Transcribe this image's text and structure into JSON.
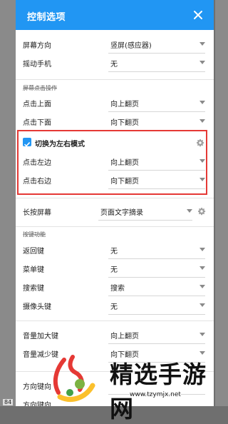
{
  "dialog": {
    "title": "控制选项",
    "close_icon": "close-icon"
  },
  "rows": {
    "orientation": {
      "label": "屏幕方向",
      "value": "竖屏(感应器)"
    },
    "shake": {
      "label": "摇动手机",
      "value": "无"
    },
    "section_tap": "屏幕点击操作",
    "tap_top": {
      "label": "点击上面",
      "value": "向上翻页"
    },
    "tap_bottom": {
      "label": "点击下面",
      "value": "向下翻页"
    },
    "toggle_lr": {
      "label": "切换为左右模式",
      "checked": true
    },
    "tap_left": {
      "label": "点击左边",
      "value": "向上翻页"
    },
    "tap_right": {
      "label": "点击右边",
      "value": "向下翻页"
    },
    "long_press": {
      "label": "长按屏幕",
      "value": "页面文字摘录"
    },
    "section_keys": "按键功能",
    "back": {
      "label": "返回键",
      "value": "无"
    },
    "menu": {
      "label": "菜单键",
      "value": "无"
    },
    "search": {
      "label": "搜索键",
      "value": "搜索"
    },
    "camera": {
      "label": "摄像头键",
      "value": "无"
    },
    "vol_up": {
      "label": "音量加大键",
      "value": "向上翻页"
    },
    "vol_down": {
      "label": "音量减少键",
      "value": "向下翻页"
    },
    "direction": {
      "label": "方向键向",
      "value": ""
    },
    "direction2": {
      "label": "方向键向",
      "value": ""
    }
  },
  "background": {
    "page_number": "84"
  },
  "watermark": {
    "brand": "精选手游网",
    "url": "www.tzymjx.net"
  },
  "colors": {
    "accent": "#2196f3",
    "highlight": "#e53935"
  }
}
